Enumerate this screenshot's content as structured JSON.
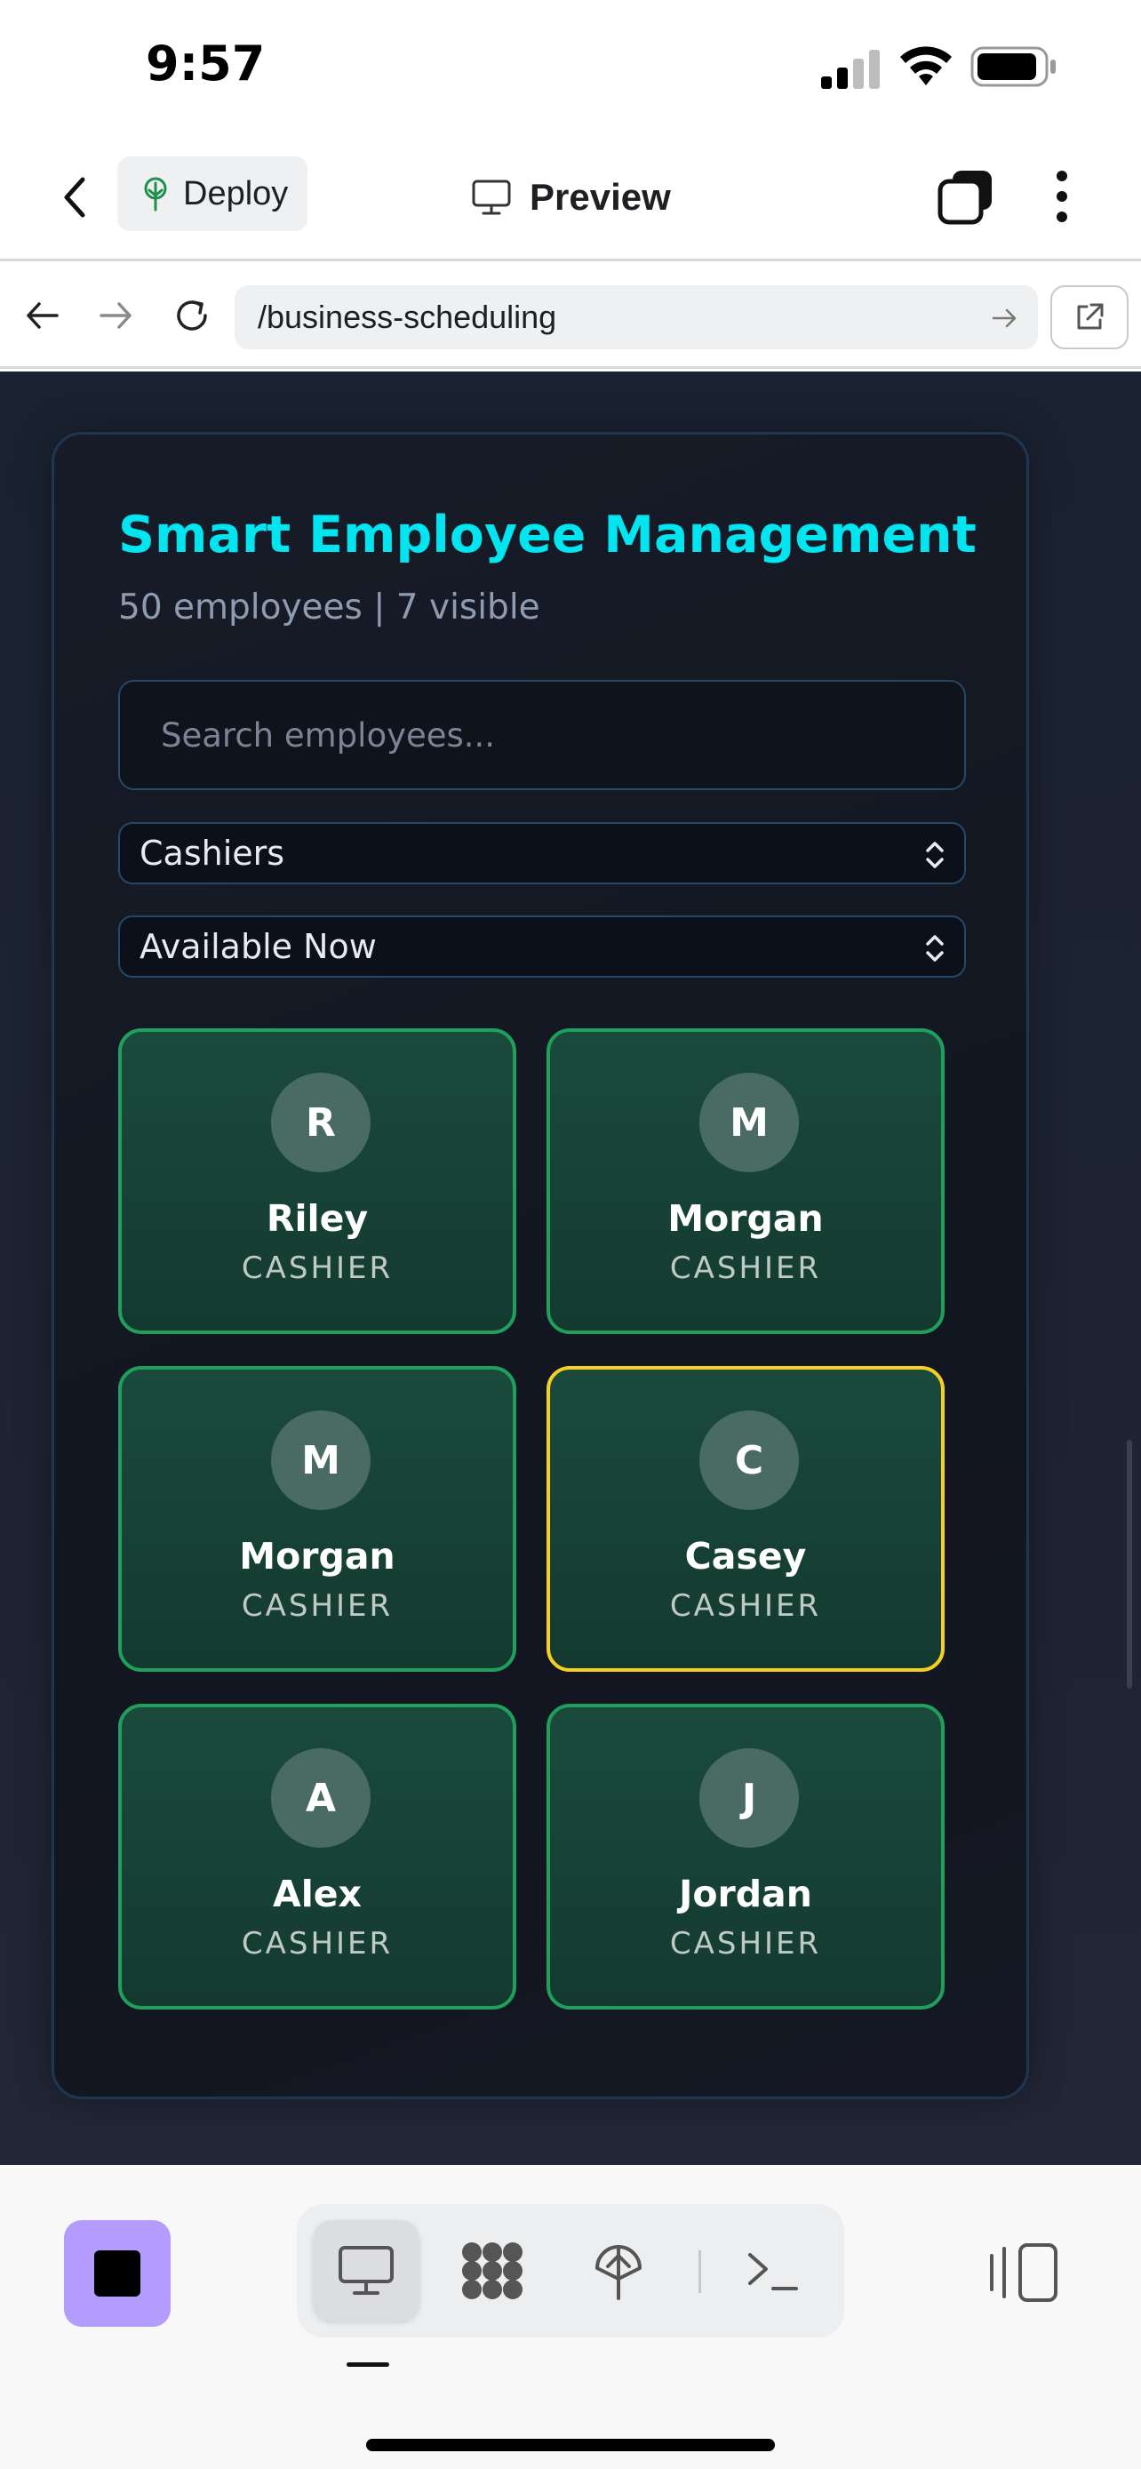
{
  "status_bar": {
    "time": "9:57"
  },
  "header": {
    "deploy_label": "Deploy",
    "preview_label": "Preview"
  },
  "url_bar": {
    "path": "/business-scheduling"
  },
  "app": {
    "title": "Smart Employee Management",
    "subtitle": "50 employees | 7 visible",
    "search_placeholder": "Search employees...",
    "role_filter": "Cashiers",
    "availability_filter": "Available Now",
    "employees": [
      {
        "initial": "R",
        "name": "Riley",
        "role": "CASHIER",
        "highlighted": false
      },
      {
        "initial": "M",
        "name": "Morgan",
        "role": "CASHIER",
        "highlighted": false
      },
      {
        "initial": "M",
        "name": "Morgan",
        "role": "CASHIER",
        "highlighted": false
      },
      {
        "initial": "C",
        "name": "Casey",
        "role": "CASHIER",
        "highlighted": true
      },
      {
        "initial": "A",
        "name": "Alex",
        "role": "CASHIER",
        "highlighted": false
      },
      {
        "initial": "J",
        "name": "Jordan",
        "role": "CASHIER",
        "highlighted": false
      }
    ]
  },
  "colors": {
    "title_accent": "#00e5f0",
    "card_border_available": "#1f9e5c",
    "card_border_highlight": "#f5d020",
    "stop_button": "#b49cff"
  },
  "icons": {
    "header": [
      "back-arrow-icon",
      "deploy-tree-icon",
      "monitor-icon",
      "tabs-icon",
      "more-vertical-icon"
    ],
    "url_bar": [
      "nav-back-icon",
      "nav-forward-icon",
      "reload-icon",
      "go-arrow-icon",
      "external-link-icon"
    ],
    "toolbar": [
      "stop-icon",
      "desktop-icon",
      "nodes-icon",
      "deploy-icon",
      "terminal-icon",
      "split-view-icon"
    ]
  }
}
